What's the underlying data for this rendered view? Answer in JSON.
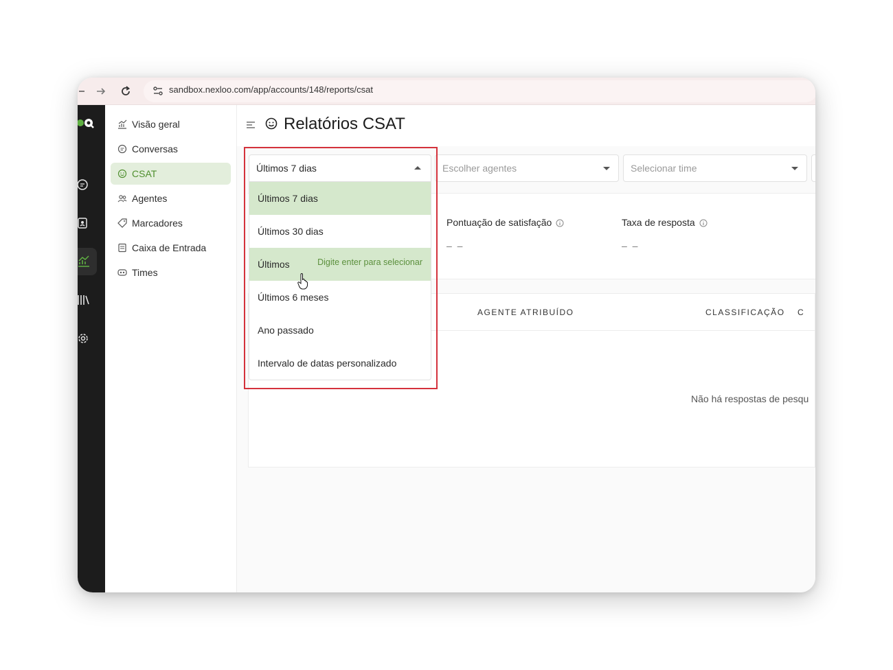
{
  "browser": {
    "url": "sandbox.nexloo.com/app/accounts/148/reports/csat",
    "nav_icons": [
      "back-icon",
      "forward-icon",
      "reload-icon"
    ]
  },
  "rail": {
    "icons": [
      "conversations-icon",
      "contacts-icon",
      "reports-icon",
      "library-icon",
      "settings-icon"
    ],
    "accent": "#4f8f2e"
  },
  "sidebar": {
    "items": [
      {
        "label": "Visão geral",
        "icon": "chart-icon"
      },
      {
        "label": "Conversas",
        "icon": "chat-icon"
      },
      {
        "label": "CSAT",
        "icon": "smile-icon",
        "active": true
      },
      {
        "label": "Agentes",
        "icon": "agents-icon"
      },
      {
        "label": "Marcadores",
        "icon": "tag-icon"
      },
      {
        "label": "Caixa de Entrada",
        "icon": "inbox-icon"
      },
      {
        "label": "Times",
        "icon": "team-icon"
      }
    ]
  },
  "header": {
    "title": "Relatórios CSAT"
  },
  "filters": {
    "date_range": {
      "selected": "Últimos 7 dias",
      "options": [
        {
          "label": "Últimos 7 dias"
        },
        {
          "label": "Últimos 30 dias"
        },
        {
          "label": "Últimos",
          "hint": "Digite enter para selecionar"
        },
        {
          "label": "Últimos 6 meses"
        },
        {
          "label": "Ano passado"
        },
        {
          "label": "Intervalo de datas personalizado"
        }
      ]
    },
    "agents_placeholder": "Escolher agentes",
    "team_placeholder": "Selecionar time"
  },
  "metrics": [
    {
      "label": "Pontuação de satisfação",
      "value": "– –"
    },
    {
      "label": "Taxa de resposta",
      "value": "– –"
    }
  ],
  "table": {
    "columns": [
      "AGENTE ATRIBUÍDO",
      "CLASSIFICAÇÃO",
      "C"
    ],
    "empty_message": "Não há respostas de pesqu"
  },
  "colors": {
    "highlight_green": "#d5e8cc",
    "annotation_red": "#d4313b"
  }
}
